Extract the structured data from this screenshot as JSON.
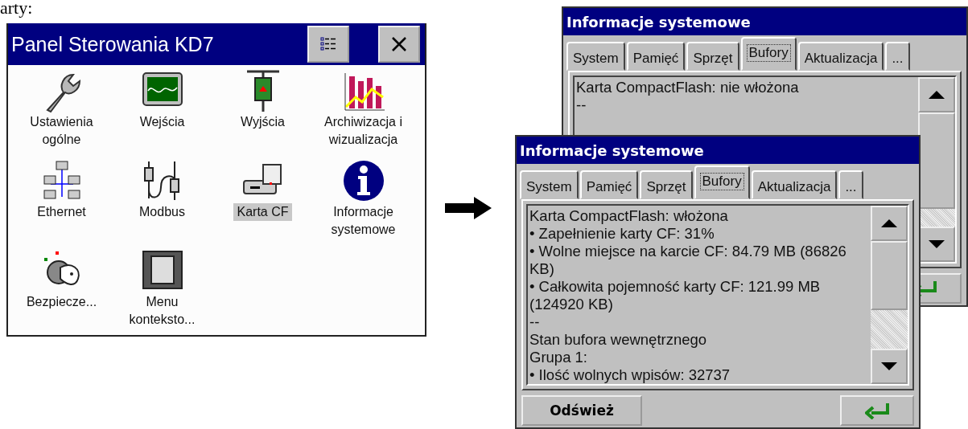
{
  "page_text": "arty:",
  "control_panel": {
    "title": "Panel Sterowania KD7",
    "items": [
      {
        "label": "Ustawienia ogólne",
        "selected": false
      },
      {
        "label": "Wejścia",
        "selected": false
      },
      {
        "label": "Wyjścia",
        "selected": false
      },
      {
        "label": "Archiwizacja i wizualizacja",
        "selected": false
      },
      {
        "label": "Ethernet",
        "selected": false
      },
      {
        "label": "Modbus",
        "selected": false
      },
      {
        "label": "Karta CF",
        "selected": true
      },
      {
        "label": "Informacje systemowe",
        "selected": false
      },
      {
        "label": "Bezpiecze...",
        "selected": false
      },
      {
        "label": "Menu konteksto...",
        "selected": false
      }
    ]
  },
  "dialogs": [
    {
      "title": "Informacje systemowe",
      "tabs": [
        {
          "label": "System",
          "selected": false
        },
        {
          "label": "Pamięć",
          "selected": false
        },
        {
          "label": "Sprzęt",
          "selected": false
        },
        {
          "label": "Bufory",
          "selected": true
        },
        {
          "label": "Aktualizacja",
          "selected": false
        },
        {
          "label": "...",
          "selected": false
        }
      ],
      "lines": [
        "Karta CompactFlash: nie włożona",
        "--"
      ]
    },
    {
      "title": "Informacje systemowe",
      "tabs": [
        {
          "label": "System",
          "selected": false
        },
        {
          "label": "Pamięć",
          "selected": false
        },
        {
          "label": "Sprzęt",
          "selected": false
        },
        {
          "label": "Bufory",
          "selected": true
        },
        {
          "label": "Aktualizacja",
          "selected": false
        },
        {
          "label": "...",
          "selected": false
        }
      ],
      "lines": [
        "Karta CompactFlash: włożona",
        "• Zapełnienie karty CF: 31%",
        "• Wolne miejsce na karcie CF: 84.79 MB (86826 KB)",
        "• Całkowita pojemność karty CF: 121.99 MB (124920 KB)",
        "--",
        "Stan bufora wewnętrznego",
        "Grupa 1:",
        "• Ilość wolnych wpisów: 32737"
      ],
      "refresh_button": "Odśwież"
    }
  ]
}
